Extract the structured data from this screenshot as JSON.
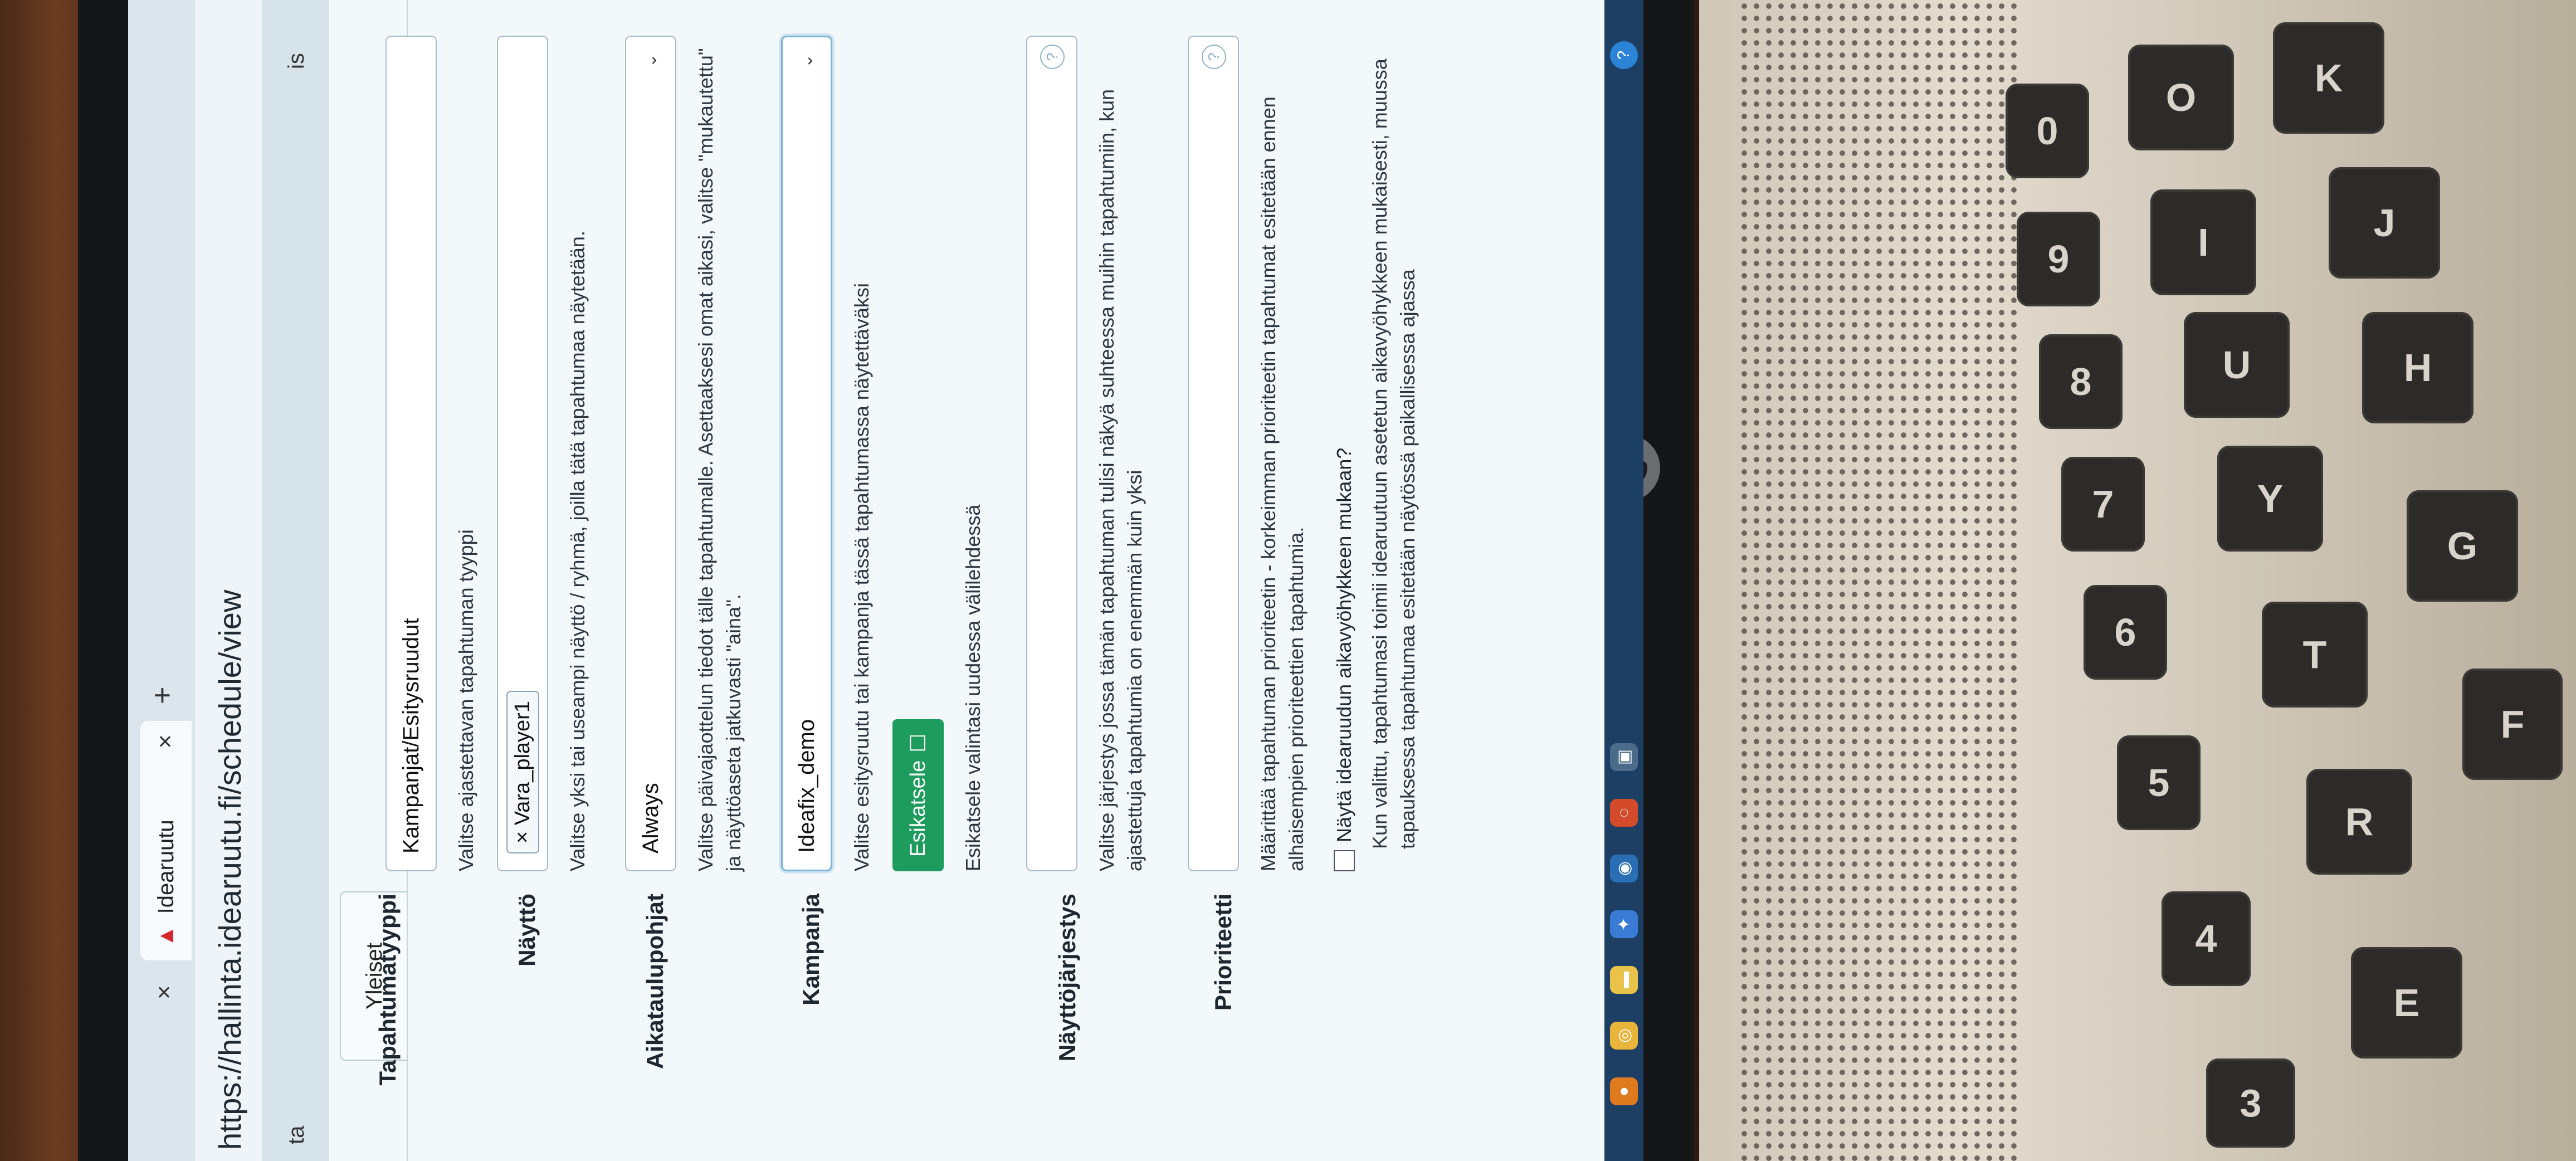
{
  "browser": {
    "tab_title": "Idearuutu",
    "url": "https://hallinta.idearuutu.fi/schedule/view",
    "close_symbol": "×",
    "new_tab_symbol": "+"
  },
  "sidebar_fragments": [
    "is",
    "ta"
  ],
  "page": {
    "tab_label": "Yleiset",
    "fields": {
      "event_type": {
        "label": "Tapahtumatyyppi",
        "value": "Kampanjat/Esitysruudut",
        "help": "Valitse ajastettavan tapahtuman tyyppi"
      },
      "display": {
        "label": "Näyttö",
        "chip": "× Vara_player1",
        "help": "Valitse yksi tai useampi näyttö / ryhmä, joilla tätä tapahtumaa näytetään."
      },
      "schedule_template": {
        "label": "Aikataulupohjat",
        "value": "Always",
        "help": "Valitse päivajaottelun tiedot tälle tapahtumalle. Asettaaksesi omat aikasi, valitse \"mukautettu\" ja näyttöaseta jatkuvasti \"aina\"."
      },
      "campaign": {
        "label": "Kampanja",
        "value": "Ideafix_demo",
        "help": "Valitse esitysruutu tai kampanja tässä tapahtumassa näytettäväksi",
        "preview_button": "Esikatsele",
        "preview_help": "Esikatsele valintasi uudessa välilehdessä"
      },
      "display_order": {
        "label": "Näyttöjärjestys",
        "help": "Valitse järjestys jossa tämän tapahtuman tulisi näkyä suhteessa muihin tapahtumiin, kun ajastettuja tapahtumia on enemmän kuin yksi"
      },
      "priority": {
        "label": "Prioriteetti",
        "help": "Määrittää tapahtuman prioriteetin - korkeimman prioriteetin tapahtumat esitetään ennen alhaisempien prioriteettien tapahtumia."
      },
      "timezone": {
        "checkbox_label": "Näytä idearuudun aikavyöhykkeen mukaan?",
        "help": "Kun valittu, tapahtumasi toimii idearuutuun asetetun aikavyöhykkeen mukaisesti, muussa tapauksessa tapahtumaa esitetään näytössä paikallisessa ajassa"
      }
    }
  },
  "keyboard": {
    "keys": [
      "0",
      "O",
      "K",
      "9",
      "I",
      "J",
      "8",
      "U",
      "H",
      "7",
      "Y",
      "G",
      "6",
      "T",
      "5",
      "R",
      "F",
      "4",
      "E",
      "3"
    ]
  }
}
